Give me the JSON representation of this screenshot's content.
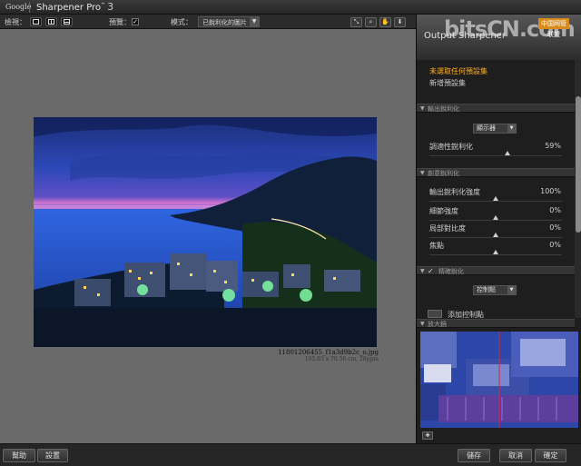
{
  "titlebar": {
    "brand": "Google",
    "app_name": "Sharpener Pro",
    "trademark": "™",
    "version": "3"
  },
  "toolbar": {
    "view_label": "檢視：",
    "preview_label": "預覽：",
    "preview_checked": "✓",
    "mode_label": "模式：",
    "mode_value": "已銳利化的圖片",
    "icons": [
      "expand-icon",
      "zoom-icon",
      "hand-icon",
      "pin-icon"
    ]
  },
  "image": {
    "filename": "11801206455_f1a3d9b2c_o.jpg",
    "dimensions": "105.83 x 70.56 cm, 28ppm"
  },
  "panel": {
    "title": "Output Sharpener",
    "watermark": "bitsCN.com",
    "watermark_badge": "中国网管联盟",
    "preset_warning": "未選取任何預設集",
    "preset_new": "新增預設集",
    "sections": {
      "output": "輸出銳利化",
      "creative": "創意銳利化",
      "selective": "精確銳化",
      "loupe": "放大鏡"
    },
    "output_device": "顯示器",
    "adaptive_label": "調適性銳利化",
    "adaptive_value": "59%",
    "adaptive_level": 0.59,
    "creative_sliders": [
      {
        "label": "輸出銳利化強度",
        "value": "100%",
        "level": 0.5
      },
      {
        "label": "細節強度",
        "value": "0%",
        "level": 0.5
      },
      {
        "label": "局部對比度",
        "value": "0%",
        "level": 0.5
      },
      {
        "label": "焦點",
        "value": "0%",
        "level": 0.5
      }
    ],
    "control_points": "控制點",
    "add_control_point": "添加控制點"
  },
  "bottom": {
    "help": "幫助",
    "settings": "設置",
    "save": "儲存",
    "cancel": "取消",
    "ok": "確定"
  },
  "colors": {
    "accent_warning": "#ffb020",
    "canvas_bg": "#6a6a6a",
    "panel_bg": "#1e1e1e"
  }
}
